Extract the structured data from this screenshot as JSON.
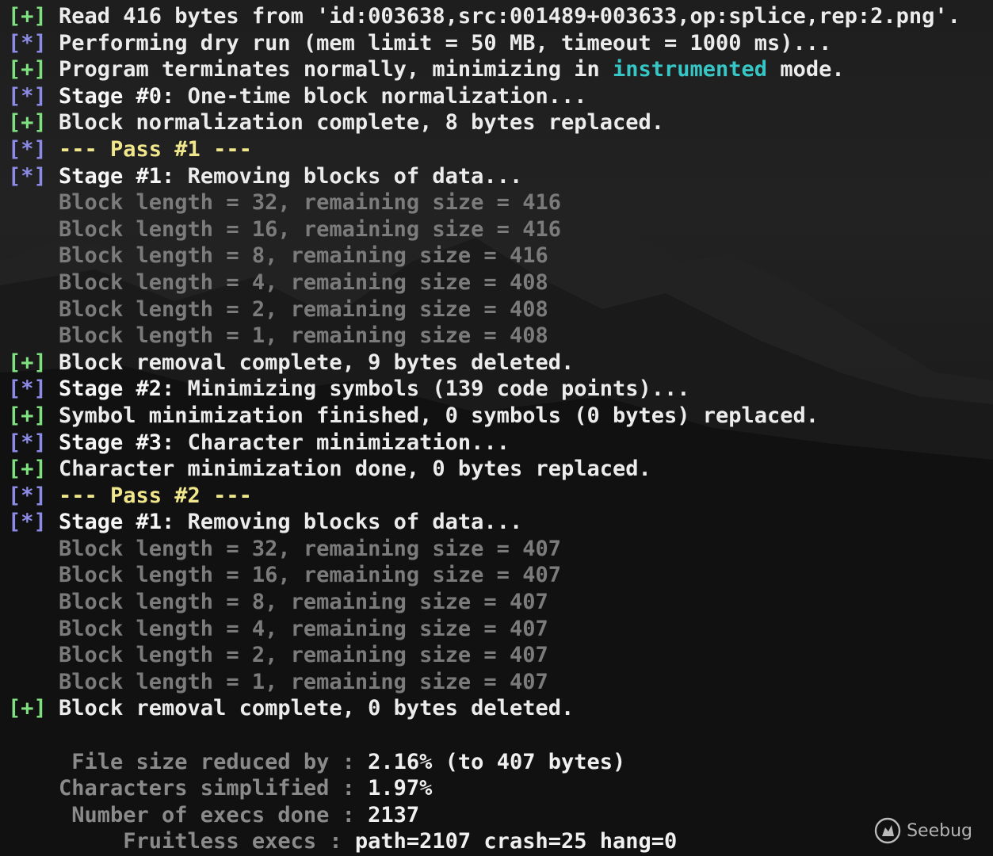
{
  "terminal": {
    "lines": [
      {
        "kind": "plus",
        "tag": "[+]",
        "text": "Read 416 bytes from 'id:003638,src:001489+003633,op:splice,rep:2.png'."
      },
      {
        "kind": "star",
        "tag": "[*]",
        "text": "Performing dry run (mem limit = 50 MB, timeout = 1000 ms)..."
      },
      {
        "kind": "plus",
        "tag": "[+]",
        "text_pre": "Program terminates normally, minimizing in ",
        "highlight": "instrumented",
        "text_post": " mode."
      },
      {
        "kind": "star",
        "tag": "[*]",
        "bold": "Stage #0:",
        "text": " One-time block normalization..."
      },
      {
        "kind": "plus",
        "tag": "[+]",
        "text": "Block normalization complete, 8 bytes replaced."
      },
      {
        "kind": "star",
        "tag": "[*]",
        "pass": "--- Pass #1 ---"
      },
      {
        "kind": "star",
        "tag": "[*]",
        "bold": "Stage #1:",
        "text": " Removing blocks of data..."
      },
      {
        "kind": "dim",
        "text": "Block length = 32, remaining size = 416"
      },
      {
        "kind": "dim",
        "text": "Block length = 16, remaining size = 416"
      },
      {
        "kind": "dim",
        "text": "Block length = 8, remaining size = 416"
      },
      {
        "kind": "dim",
        "text": "Block length = 4, remaining size = 408"
      },
      {
        "kind": "dim",
        "text": "Block length = 2, remaining size = 408"
      },
      {
        "kind": "dim",
        "text": "Block length = 1, remaining size = 408"
      },
      {
        "kind": "plus",
        "tag": "[+]",
        "text": "Block removal complete, 9 bytes deleted."
      },
      {
        "kind": "star",
        "tag": "[*]",
        "bold": "Stage #2:",
        "text": " Minimizing symbols (139 code points)..."
      },
      {
        "kind": "plus",
        "tag": "[+]",
        "text": "Symbol minimization finished, 0 symbols (0 bytes) replaced."
      },
      {
        "kind": "star",
        "tag": "[*]",
        "bold": "Stage #3:",
        "text": " Character minimization..."
      },
      {
        "kind": "plus",
        "tag": "[+]",
        "text": "Character minimization done, 0 bytes replaced."
      },
      {
        "kind": "star",
        "tag": "[*]",
        "pass": "--- Pass #2 ---"
      },
      {
        "kind": "star",
        "tag": "[*]",
        "bold": "Stage #1:",
        "text": " Removing blocks of data..."
      },
      {
        "kind": "dim",
        "text": "Block length = 32, remaining size = 407"
      },
      {
        "kind": "dim",
        "text": "Block length = 16, remaining size = 407"
      },
      {
        "kind": "dim",
        "text": "Block length = 8, remaining size = 407"
      },
      {
        "kind": "dim",
        "text": "Block length = 4, remaining size = 407"
      },
      {
        "kind": "dim",
        "text": "Block length = 2, remaining size = 407"
      },
      {
        "kind": "dim",
        "text": "Block length = 1, remaining size = 407"
      },
      {
        "kind": "plus",
        "tag": "[+]",
        "text": "Block removal complete, 0 bytes deleted."
      },
      {
        "kind": "blank"
      },
      {
        "kind": "stat",
        "label": " File size reduced by : ",
        "value": "2.16% (to 407 bytes)"
      },
      {
        "kind": "stat",
        "label": "Characters simplified : ",
        "value": "1.97%"
      },
      {
        "kind": "stat",
        "label": " Number of execs done : ",
        "value": "2137"
      },
      {
        "kind": "stat",
        "label": "     Fruitless execs : ",
        "value": "path=2107 crash=25 hang=0"
      }
    ]
  },
  "watermark": {
    "text": "Seebug",
    "icon": "seebug-logo-icon"
  },
  "colors": {
    "plus_tag": "#7fe07f",
    "star_tag": "#8c8ce8",
    "highlight": "#36c6c6",
    "pass": "#f0e68c",
    "dim": "#7b7b7b"
  }
}
